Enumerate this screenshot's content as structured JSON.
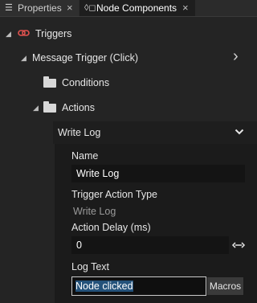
{
  "tabs": [
    {
      "label": "Properties",
      "close": "×"
    },
    {
      "label": "Node Components",
      "close": "×"
    }
  ],
  "tree": {
    "triggers": "Triggers",
    "message_trigger": "Message Trigger (Click)",
    "conditions": "Conditions",
    "actions": "Actions",
    "write_log": "Write Log"
  },
  "panel": {
    "name_label": "Name",
    "name_value": "Write Log",
    "type_label": "Trigger Action Type",
    "type_value": "Write Log",
    "delay_label": "Action Delay (ms)",
    "delay_value": "0",
    "log_text_label": "Log Text",
    "log_text_value": "Node clicked",
    "macros_button": "Macros"
  },
  "icons": {
    "expanded_arrow": "◢",
    "chevron_right": "›",
    "chevron_down": "⌄",
    "drag_arrows": "↔"
  }
}
